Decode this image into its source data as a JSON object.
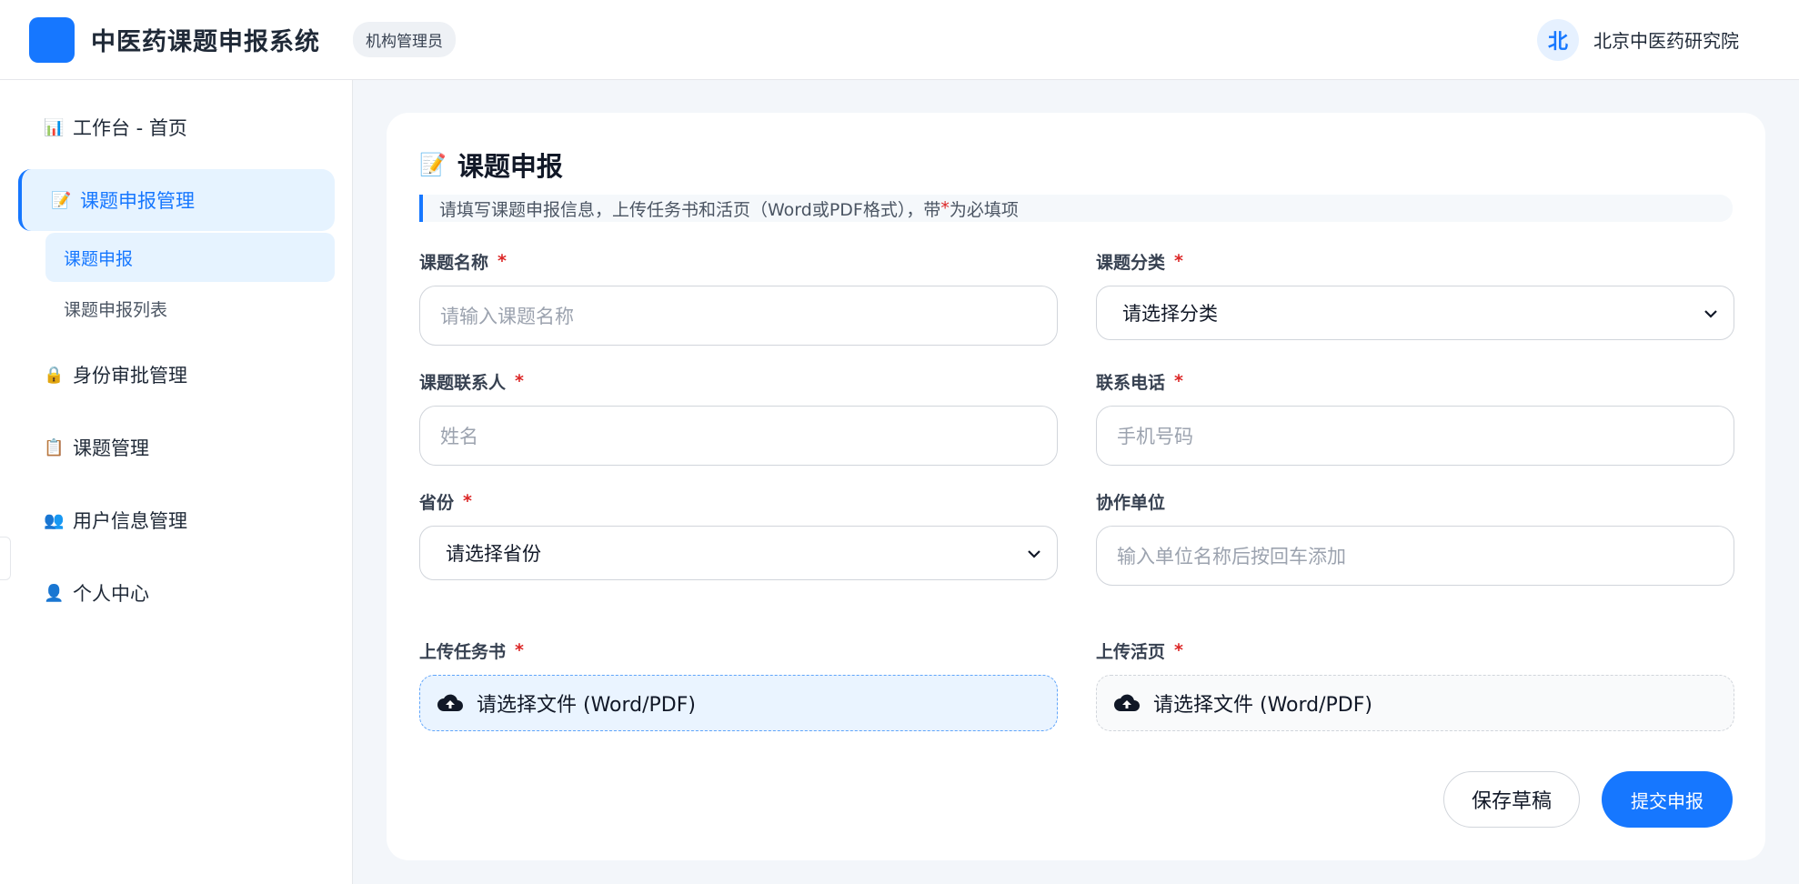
{
  "header": {
    "app_title": "中医药课题申报系统",
    "role_badge": "机构管理员",
    "avatar_letter": "北",
    "org_name": "北京中医药研究院",
    "brand_color": "#1677ff"
  },
  "sidebar": {
    "items": [
      {
        "icon": "bar-chart-icon",
        "glyph": "📊",
        "label": "工作台 - 首页"
      },
      {
        "icon": "memo-icon",
        "glyph": "📝",
        "label": "课题申报管理"
      },
      {
        "icon": "lock-icon",
        "glyph": "🔒",
        "label": "身份审批管理"
      },
      {
        "icon": "clipboard-icon",
        "glyph": "📋",
        "label": "课题管理"
      },
      {
        "icon": "users-icon",
        "glyph": "👥",
        "label": "用户信息管理"
      },
      {
        "icon": "user-icon",
        "glyph": "👤",
        "label": "个人中心"
      }
    ],
    "sub_items": [
      {
        "label": "课题申报"
      },
      {
        "label": "课题申报列表"
      }
    ]
  },
  "main": {
    "title_glyph": "📝",
    "title": "课题申报",
    "hint_prefix": "请填写课题申报信息，上传任务书和活页（Word或PDF格式），带",
    "hint_star": "*",
    "hint_suffix": "为必填项",
    "fields": {
      "topic_name": {
        "label": "课题名称",
        "placeholder": "请输入课题名称"
      },
      "category": {
        "label": "课题分类",
        "selected": "请选择分类"
      },
      "contact": {
        "label": "课题联系人",
        "placeholder": "姓名"
      },
      "phone": {
        "label": "联系电话",
        "placeholder": "手机号码"
      },
      "province": {
        "label": "省份",
        "selected": "请选择省份"
      },
      "partner": {
        "label": "协作单位",
        "placeholder": "输入单位名称后按回车添加"
      },
      "task_book": {
        "label": "上传任务书",
        "button": "请选择文件 (Word/PDF)"
      },
      "leaflet": {
        "label": "上传活页",
        "button": "请选择文件 (Word/PDF)"
      }
    },
    "required_star": "*",
    "actions": {
      "save_draft": "保存草稿",
      "submit": "提交申报"
    }
  }
}
